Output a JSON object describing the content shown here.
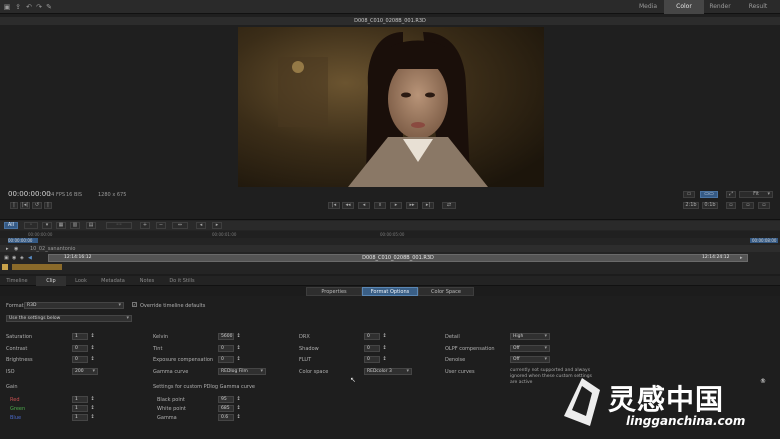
{
  "app": {
    "modes": [
      "Media",
      "Color",
      "Render",
      "Result"
    ],
    "active_mode": "Color",
    "toolbar_icons": [
      "folder-icon",
      "export-icon",
      "undo-icon",
      "redo-icon",
      "wrench-icon"
    ]
  },
  "viewer": {
    "clip_title": "D008_C010_0208B_001.R3D",
    "timecode": "00:00:00:00",
    "fps": "24 FPS",
    "bits": "16 BIS",
    "resolution": "1280 x 675",
    "fit_label": "Fit",
    "zoom_a": "2:1b",
    "zoom_b": "0:1b"
  },
  "timeline": {
    "track_name": "10_02_sanantonio",
    "clip_name": "D008_C010_0208B_001.R3D",
    "tc_start": "00:00:00:00",
    "tc_in": "12:14:16:12",
    "tc_out": "12:14:24:12",
    "tc_end": "00:00:08:00",
    "tc_mid1": "00:00:01:00",
    "tc_mid2": "00:00:05:00",
    "filter_all": "All"
  },
  "sub_tabs": [
    "Timeline",
    "Clip",
    "Look",
    "Metadata",
    "Notes",
    "Do it Stills"
  ],
  "active_sub_tab": "Clip",
  "format_tabs": [
    "Properties",
    "Format Options",
    "Color Space"
  ],
  "active_format_tab": "Format Options",
  "format": {
    "format_label": "Format",
    "format_value": "R3D",
    "override_label": "Override timeline defaults",
    "settings_value": "Use the settings below"
  },
  "col1": [
    {
      "label": "Saturation",
      "value": "1"
    },
    {
      "label": "Contrast",
      "value": "0"
    },
    {
      "label": "Brightness",
      "value": "0"
    },
    {
      "label": "ISO",
      "value": "200"
    }
  ],
  "gain": {
    "label": "Gain",
    "rows": [
      {
        "label": "Red",
        "value": "1"
      },
      {
        "label": "Green",
        "value": "1"
      },
      {
        "label": "Blue",
        "value": "1"
      }
    ]
  },
  "col2": [
    {
      "label": "Kelvin",
      "value": "5600"
    },
    {
      "label": "Tint",
      "value": "0"
    },
    {
      "label": "Exposure compensation",
      "value": "0"
    },
    {
      "label": "Gamma curve",
      "value": "REDlog Film"
    }
  ],
  "gamma_custom": {
    "heading": "Settings for custom PDlog Gamma curve",
    "rows": [
      {
        "label": "Black point",
        "value": "95"
      },
      {
        "label": "White point",
        "value": "685"
      },
      {
        "label": "Gamma",
        "value": "0.6"
      }
    ]
  },
  "col3": [
    {
      "label": "DRX",
      "value": "0"
    },
    {
      "label": "Shadow",
      "value": "0"
    },
    {
      "label": "FLUT",
      "value": "0"
    },
    {
      "label": "Color space",
      "value": "REDcolor 3"
    }
  ],
  "col4": [
    {
      "label": "Detail",
      "value": "High"
    },
    {
      "label": "OLPF compensation",
      "value": "Off"
    },
    {
      "label": "Denoise",
      "value": "Off"
    },
    {
      "label": "User curves",
      "value": ""
    }
  ],
  "user_curves_note": "currently not supported and always ignored when these custom settings are active",
  "watermark": {
    "cn": "灵感中国",
    "url": "lingganchina.com",
    "mark": "®"
  }
}
